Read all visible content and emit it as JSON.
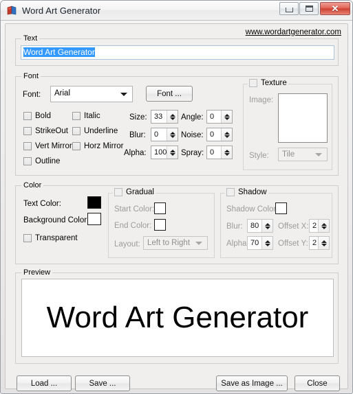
{
  "window": {
    "title": "Word Art Generator",
    "icon": "wordart-app-icon",
    "buttons": {
      "minimize": "minimize-icon",
      "maximize": "maximize-icon",
      "close": "✕"
    }
  },
  "site_link": "www.wordartgenerator.com",
  "text_section": {
    "title": "Text",
    "value": "Word Art Generator",
    "selected": true
  },
  "font_section": {
    "title": "Font",
    "font_label": "Font:",
    "font_value": "Arial",
    "font_button": "Font ...",
    "checkboxes": [
      {
        "label": "Bold",
        "checked": false
      },
      {
        "label": "Italic",
        "checked": false
      },
      {
        "label": "StrikeOut",
        "checked": false
      },
      {
        "label": "Underline",
        "checked": false
      },
      {
        "label": "Vert Mirror",
        "checked": false
      },
      {
        "label": "Horz Mirror",
        "checked": false
      },
      {
        "label": "Outline",
        "checked": false
      }
    ],
    "numbers": [
      {
        "label": "Size:",
        "value": "33"
      },
      {
        "label": "Angle:",
        "value": "0"
      },
      {
        "label": "Blur:",
        "value": "0"
      },
      {
        "label": "Noise:",
        "value": "0"
      },
      {
        "label": "Alpha:",
        "value": "100"
      },
      {
        "label": "Spray:",
        "value": "0"
      }
    ]
  },
  "texture_section": {
    "title": "Texture",
    "checked": false,
    "enabled": false,
    "image_label": "Image:",
    "style_label": "Style:",
    "style_value": "Tile"
  },
  "color_section": {
    "title": "Color",
    "text_color_label": "Text Color:",
    "text_color": "#000000",
    "background_color_label": "Background Color:",
    "background_color": "#ffffff",
    "transparent": {
      "label": "Transparent",
      "checked": false
    }
  },
  "gradual_section": {
    "title": "Gradual",
    "checked": false,
    "enabled": false,
    "start_color_label": "Start Color:",
    "start_color": "#ffffff",
    "end_color_label": "End Color:",
    "end_color": "#ffffff",
    "layout_label": "Layout:",
    "layout_value": "Left to Right"
  },
  "shadow_section": {
    "title": "Shadow",
    "checked": false,
    "enabled": false,
    "shadow_color_label": "Shadow Color:",
    "shadow_color": "#ffffff",
    "fields": [
      {
        "label": "Blur:",
        "value": "80"
      },
      {
        "label": "Offset X:",
        "value": "2"
      },
      {
        "label": "Alpha:",
        "value": "70"
      },
      {
        "label": "Offset Y:",
        "value": "2"
      }
    ]
  },
  "preview_section": {
    "title": "Preview",
    "text": "Word Art Generator"
  },
  "footer": {
    "load": "Load ...",
    "save": "Save ...",
    "save_as_image": "Save as Image ...",
    "close": "Close"
  },
  "colors": {
    "selection_blue": "#3399ff",
    "close_red": "#cf4231",
    "window_bg": "#f0efee"
  }
}
